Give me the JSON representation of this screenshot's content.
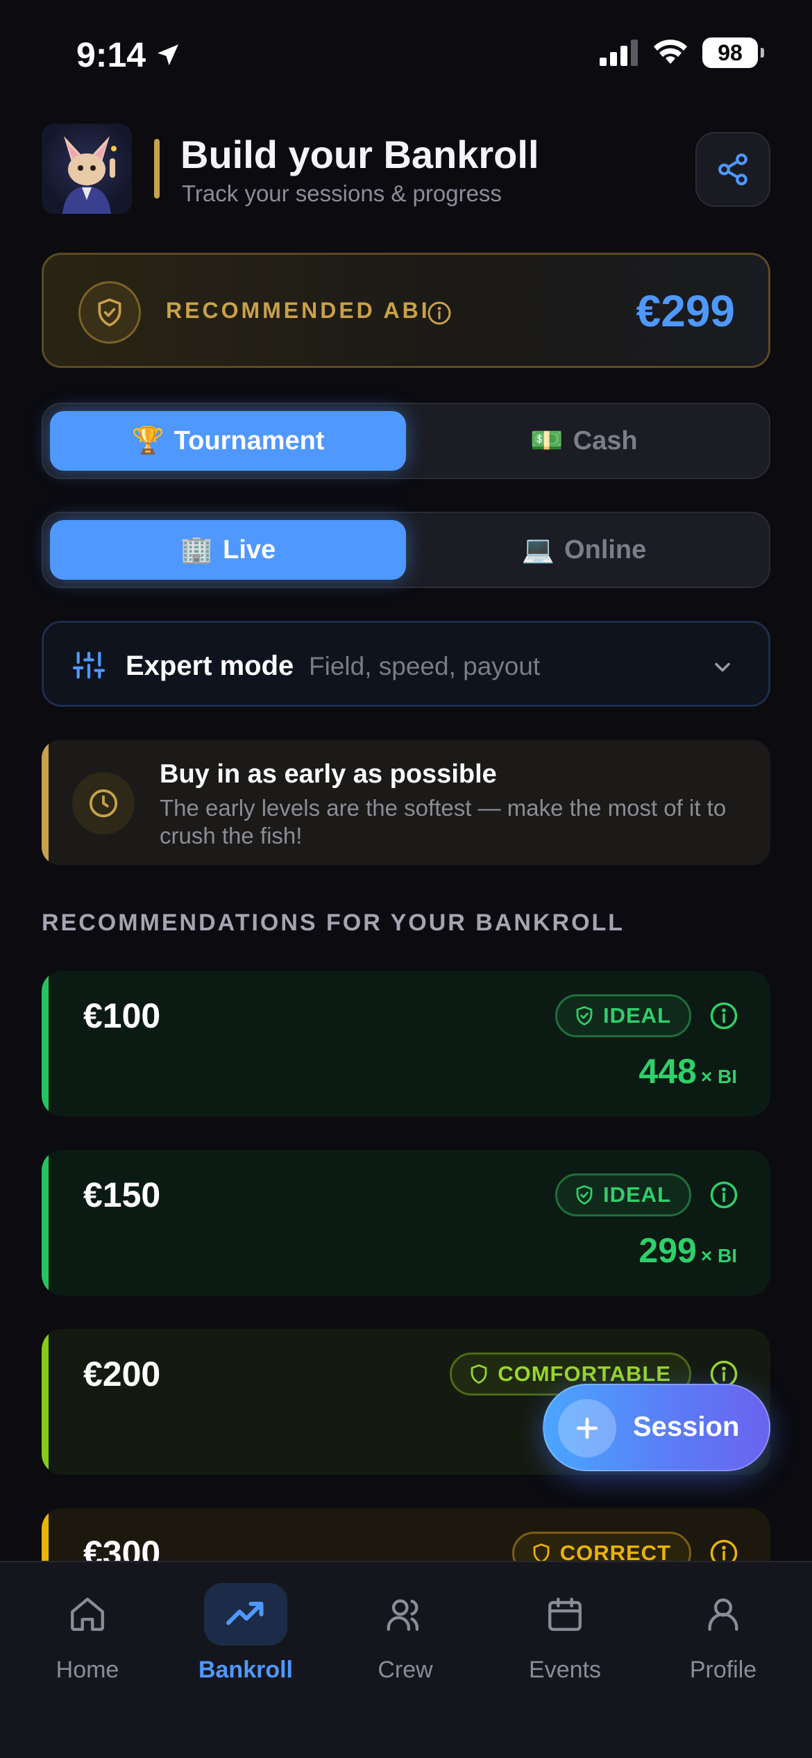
{
  "status_bar": {
    "time": "9:14",
    "battery": "98"
  },
  "header": {
    "title": "Build your Bankroll",
    "subtitle": "Track your sessions & progress",
    "share_icon": "share-icon"
  },
  "abi": {
    "label": "RECOMMENDED ABI",
    "value": "€299",
    "color": "#4f98ff"
  },
  "game_type": {
    "options": [
      {
        "emoji": "🏆",
        "label": "Tournament",
        "active": true
      },
      {
        "emoji": "💵",
        "label": "Cash",
        "active": false
      }
    ]
  },
  "venue": {
    "options": [
      {
        "emoji": "🏢",
        "label": "Live",
        "active": true
      },
      {
        "emoji": "💻",
        "label": "Online",
        "active": false
      }
    ]
  },
  "expert_mode": {
    "title": "Expert mode",
    "description": "Field, speed, payout"
  },
  "tip": {
    "title": "Buy in as early as possible",
    "body": "The early levels are the softest — make the most of it to crush the fish!"
  },
  "recommendations": {
    "heading": "RECOMMENDATIONS FOR YOUR BANKROLL",
    "items": [
      {
        "amount": "€100",
        "badge": "IDEAL",
        "multiple": "448",
        "unit": "× BI",
        "color": "#22c55e"
      },
      {
        "amount": "€150",
        "badge": "IDEAL",
        "multiple": "299",
        "unit": "× BI",
        "color": "#22c55e"
      },
      {
        "amount": "€200",
        "badge": "COMFORTABLE",
        "color": "#84cc16"
      },
      {
        "amount": "€300",
        "badge": "CORRECT",
        "color": "#eab308"
      }
    ]
  },
  "session_button": {
    "label": "Session"
  },
  "nav": {
    "items": [
      {
        "label": "Home",
        "icon": "home-icon"
      },
      {
        "label": "Bankroll",
        "icon": "trending-up-icon",
        "active": true
      },
      {
        "label": "Crew",
        "icon": "users-icon"
      },
      {
        "label": "Events",
        "icon": "calendar-icon"
      },
      {
        "label": "Profile",
        "icon": "user-icon"
      }
    ]
  },
  "accent": "#4f98ff"
}
